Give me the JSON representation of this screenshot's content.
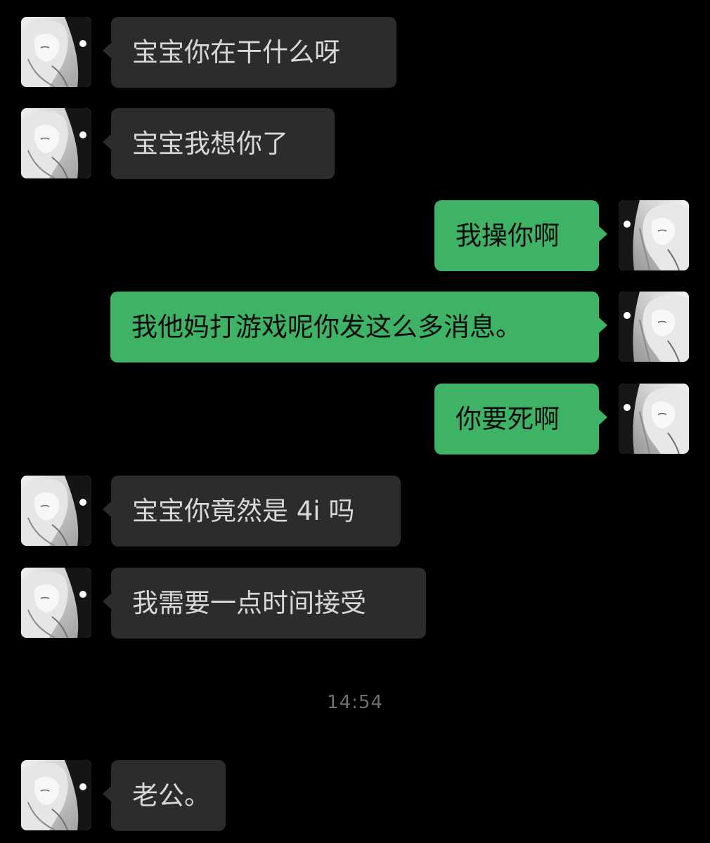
{
  "conversation": {
    "messages": [
      {
        "side": "in",
        "text": "宝宝你在干什么呀"
      },
      {
        "side": "in",
        "text": "宝宝我想你了"
      },
      {
        "side": "out",
        "text": "我操你啊"
      },
      {
        "side": "out",
        "text": "我他妈打游戏呢你发这么多消息。"
      },
      {
        "side": "out",
        "text": "你要死啊"
      },
      {
        "side": "in",
        "text": "宝宝你竟然是 4i 吗"
      },
      {
        "side": "in",
        "text": "我需要一点时间接受"
      },
      {
        "side": "in",
        "text": "老公。"
      }
    ],
    "timestamp": "14:54"
  },
  "avatars": {
    "contact": {
      "icon": "anime-girl-avatar-icon",
      "tone": "grayscale"
    },
    "self": {
      "icon": "anime-girl-avatar-icon",
      "tone": "grayscale"
    }
  },
  "colors": {
    "background": "#000000",
    "incoming_bubble": "#2c2c2c",
    "outgoing_bubble": "#3fb365",
    "incoming_text": "#d8d8d8",
    "outgoing_text": "#0b0b0b",
    "timestamp": "#6f6f6f"
  }
}
